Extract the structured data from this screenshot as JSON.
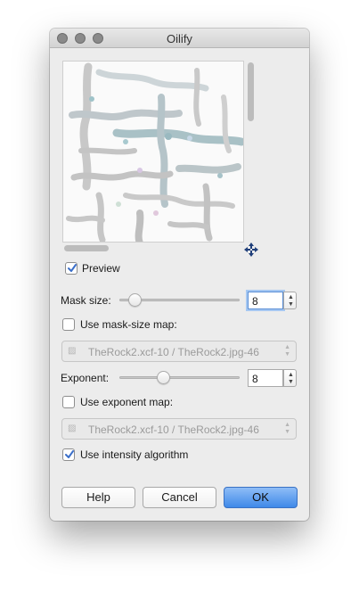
{
  "window": {
    "title": "Oilify"
  },
  "preview": {
    "label": "Preview",
    "checked": true
  },
  "mask_size": {
    "label": "Mask size:",
    "value": "8",
    "slider_fraction": 0.1
  },
  "use_mask_size_map": {
    "label": "Use mask-size map:",
    "checked": false,
    "combo_text": "TheRock2.xcf-10 / TheRock2.jpg-46"
  },
  "exponent": {
    "label": "Exponent:",
    "value": "8",
    "slider_fraction": 0.38
  },
  "use_exponent_map": {
    "label": "Use exponent map:",
    "checked": false,
    "combo_text": "TheRock2.xcf-10 / TheRock2.jpg-46"
  },
  "use_intensity": {
    "label": "Use intensity algorithm",
    "checked": true
  },
  "buttons": {
    "help": "Help",
    "cancel": "Cancel",
    "ok": "OK"
  },
  "colors": {
    "accent": "#3f89e8",
    "checkbox_check": "#3b6fc9"
  },
  "icons": {
    "move": "move-arrows-icon",
    "check": "checkmark-icon",
    "combo": "image-icon"
  }
}
